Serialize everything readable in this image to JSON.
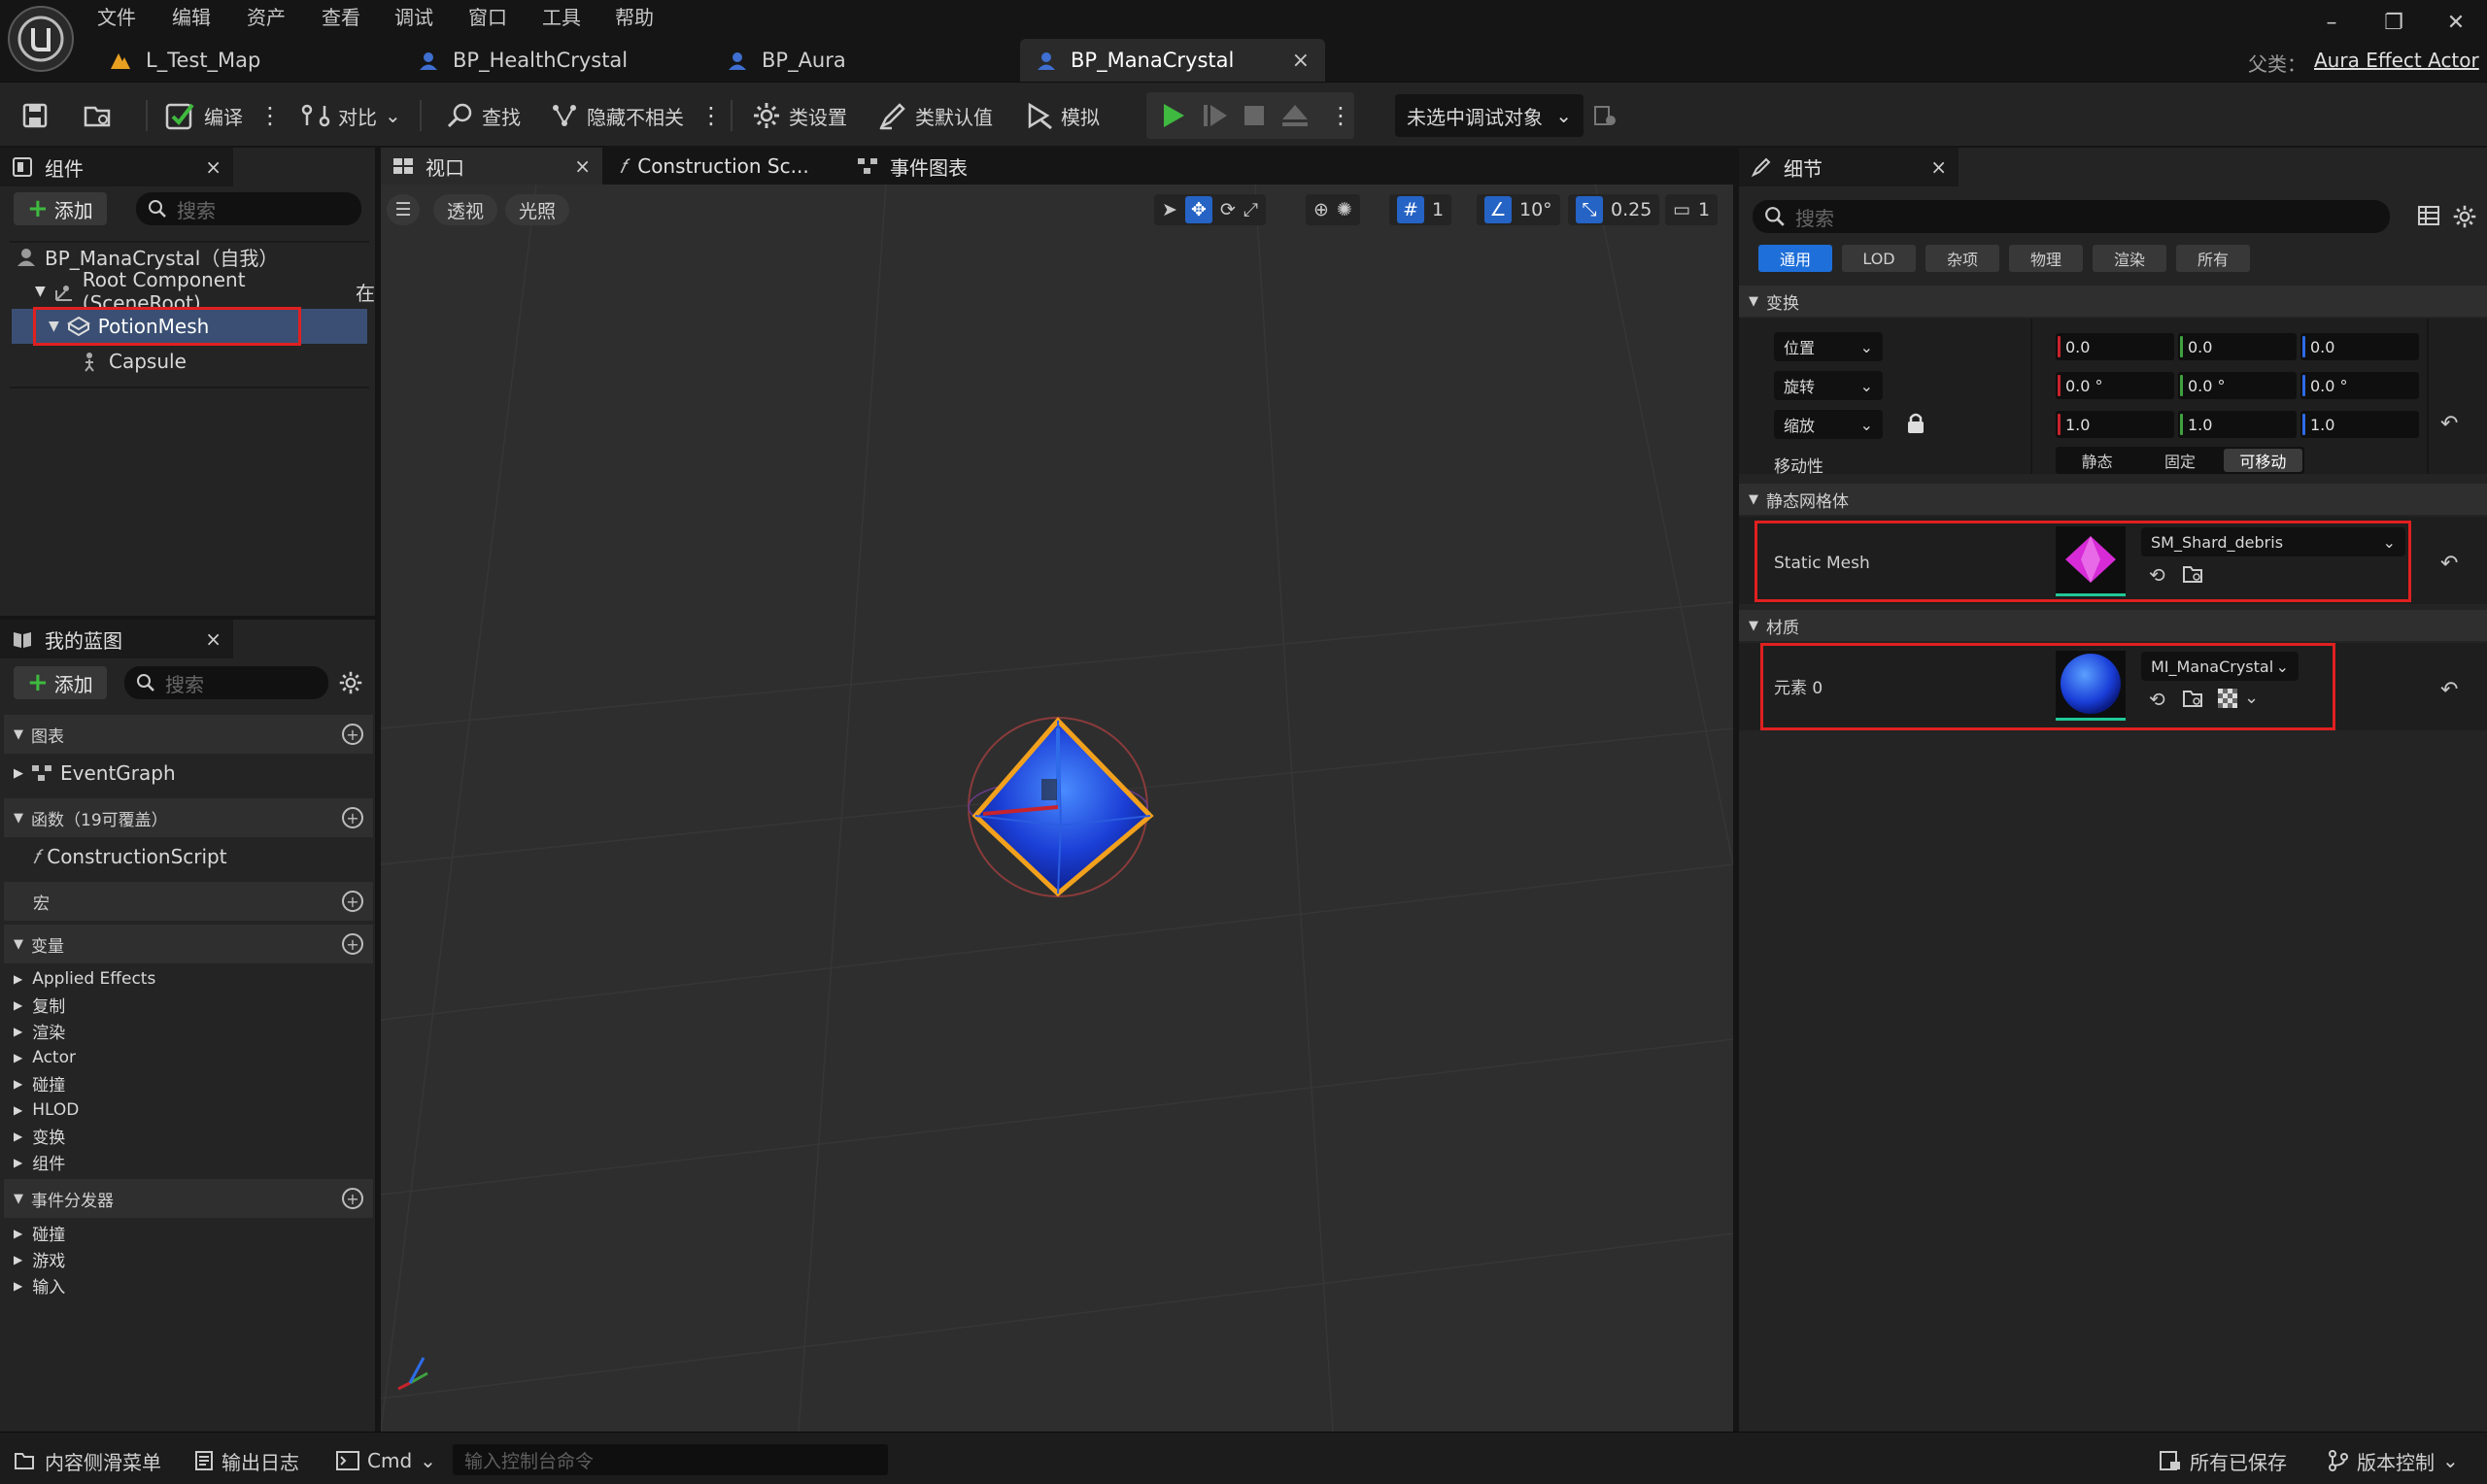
{
  "menu": [
    "文件",
    "编辑",
    "资产",
    "查看",
    "调试",
    "窗口",
    "工具",
    "帮助"
  ],
  "doc_tabs": [
    {
      "label": "L_Test_Map"
    },
    {
      "label": "BP_HealthCrystal"
    },
    {
      "label": "BP_Aura"
    },
    {
      "label": "BP_ManaCrystal"
    }
  ],
  "parent_class": {
    "label": "父类：",
    "value": "Aura Effect Actor"
  },
  "toolbar": {
    "compile": "编译",
    "diff": "对比",
    "find": "查找",
    "hide_unrelated": "隐藏不相关",
    "class_settings": "类设置",
    "class_defaults": "类默认值",
    "simulate": "模拟",
    "debug_target": "未选中调试对象"
  },
  "components_panel": {
    "title": "组件",
    "add": "添加",
    "search_placeholder": "搜索",
    "tree": [
      {
        "label": "BP_ManaCrystal（自我）"
      },
      {
        "label": "Root Component (SceneRoot)",
        "suffix": "在"
      },
      {
        "label": "PotionMesh"
      },
      {
        "label": "Capsule"
      }
    ]
  },
  "my_blueprint": {
    "title": "我的蓝图",
    "add": "添加",
    "search_placeholder": "搜索",
    "sections": {
      "graphs": "图表",
      "event_graph": "EventGraph",
      "functions": "函数（19可覆盖）",
      "construction_script": "ConstructionScript",
      "macros": "宏",
      "variables": "变量",
      "dispatchers": "事件分发器"
    },
    "variables": [
      "Applied Effects",
      "复制",
      "渲染",
      "Actor",
      "碰撞",
      "HLOD",
      "变换",
      "组件"
    ],
    "dispatchers": [
      "碰撞",
      "游戏",
      "输入"
    ]
  },
  "center_tabs": [
    {
      "label": "视口"
    },
    {
      "label": "Construction Sc..."
    },
    {
      "label": "事件图表"
    }
  ],
  "viewport": {
    "perspective": "透视",
    "lighting": "光照",
    "grid_snap": "1",
    "rotation_snap": "10°",
    "scale_snap": "0.25",
    "camera_speed": "1"
  },
  "details": {
    "title": "细节",
    "search_placeholder": "搜索",
    "filters": [
      "通用",
      "LOD",
      "杂项",
      "物理",
      "渲染",
      "所有"
    ],
    "transform": {
      "header": "变换",
      "location": {
        "label": "位置",
        "x": "0.0",
        "y": "0.0",
        "z": "0.0"
      },
      "rotation": {
        "label": "旋转",
        "x": "0.0 °",
        "y": "0.0 °",
        "z": "0.0 °"
      },
      "scale": {
        "label": "缩放",
        "x": "1.0",
        "y": "1.0",
        "z": "1.0"
      },
      "mobility": {
        "label": "移动性",
        "options": [
          "静态",
          "固定",
          "可移动"
        ],
        "selected": "可移动"
      }
    },
    "static_mesh": {
      "header": "静态网格体",
      "label": "Static Mesh",
      "value": "SM_Shard_debris"
    },
    "materials": {
      "header": "材质",
      "label": "元素 0",
      "value": "MI_ManaCrystal"
    }
  },
  "statusbar": {
    "content_drawer": "内容侧滑菜单",
    "output_log": "输出日志",
    "cmd": "Cmd",
    "console_placeholder": "输入控制台命令",
    "all_saved": "所有已保存",
    "version_control": "版本控制"
  },
  "colors": {
    "accent_blue": "#1e6fd9",
    "highlight_red": "#e02020",
    "play_green": "#3fb93f"
  }
}
